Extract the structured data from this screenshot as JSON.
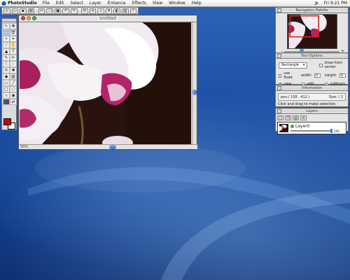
{
  "menubar": {
    "app_name": "PhotoStudio",
    "menus": [
      "File",
      "Edit",
      "Select",
      "Layer",
      "Enhance",
      "Effects",
      "View",
      "Window",
      "Help"
    ],
    "clock": "Fri 9:21 PM"
  },
  "document": {
    "title": "Untitled",
    "zoom": "50%"
  },
  "panels": {
    "navigation": {
      "title": "Navigation Palette",
      "zoom_out": "-",
      "zoom_in": "+"
    },
    "tool_options": {
      "title": "Tool Options",
      "shape": "Rectangle",
      "draw_from_center": "draw from center",
      "use_fixed": "use fixed",
      "width_label": "width:",
      "width_value": "0",
      "height_label": "height:",
      "height_value": "0",
      "modes": [
        "new",
        "add",
        "subtract"
      ]
    },
    "information": {
      "title": "Information",
      "position": "pos:( 158 , 412 )",
      "size": "Size: ( 2",
      "hint": "Click and drag to make selection."
    },
    "layers": {
      "title": "Layers",
      "layer_name": "Layer0",
      "opacity": "100"
    }
  },
  "colors": {
    "foreground": "#d10000",
    "background": "#ffffff",
    "accent": "#2e6fd0"
  }
}
